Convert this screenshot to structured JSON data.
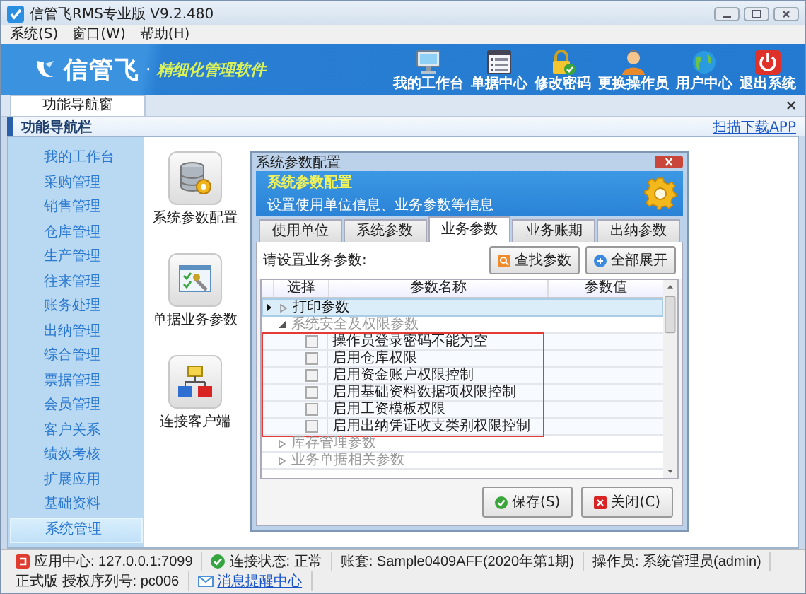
{
  "window": {
    "title": "信管飞RMS专业版 V9.2.480"
  },
  "menu": [
    {
      "label": "系统(S)"
    },
    {
      "label": "窗口(W)"
    },
    {
      "label": "帮助(H)"
    }
  ],
  "banner": {
    "logo": "信管飞",
    "separator": "·",
    "tagline": "精细化管理软件",
    "tools": [
      {
        "label": "我的工作台",
        "kind": "monitor"
      },
      {
        "label": "单据中心",
        "kind": "list"
      },
      {
        "label": "修改密码",
        "kind": "lock"
      },
      {
        "label": "更换操作员",
        "kind": "user"
      },
      {
        "label": "用户中心",
        "kind": "globe"
      },
      {
        "label": "退出系统",
        "kind": "power"
      }
    ]
  },
  "doc_tabs": [
    {
      "label": "功能导航窗",
      "selected": true
    }
  ],
  "nav": {
    "title": "功能导航栏",
    "link": "扫描下载APP",
    "items": [
      {
        "label": "我的工作台",
        "selected": false
      },
      {
        "label": "采购管理",
        "selected": false
      },
      {
        "label": "销售管理",
        "selected": false
      },
      {
        "label": "仓库管理",
        "selected": false
      },
      {
        "label": "生产管理",
        "selected": false
      },
      {
        "label": "往来管理",
        "selected": false
      },
      {
        "label": "账务处理",
        "selected": false
      },
      {
        "label": "出纳管理",
        "selected": false
      },
      {
        "label": "综合管理",
        "selected": false
      },
      {
        "label": "票据管理",
        "selected": false
      },
      {
        "label": "会员管理",
        "selected": false
      },
      {
        "label": "客户关系",
        "selected": false
      },
      {
        "label": "绩效考核",
        "selected": false
      },
      {
        "label": "扩展应用",
        "selected": false
      },
      {
        "label": "基础资料",
        "selected": false
      },
      {
        "label": "系统管理",
        "selected": true
      }
    ]
  },
  "shortcuts": [
    {
      "label": "系统参数配置",
      "kind": "database"
    },
    {
      "label": "单据业务参数",
      "kind": "form"
    },
    {
      "label": "连接客户端",
      "kind": "network"
    }
  ],
  "dialog": {
    "title": "系统参数配置",
    "header_title": "系统参数配置",
    "header_subtitle": "设置使用单位信息、业务参数等信息",
    "tabs": [
      {
        "label": "使用单位",
        "selected": false
      },
      {
        "label": "系统参数",
        "selected": false
      },
      {
        "label": "业务参数",
        "selected": true
      },
      {
        "label": "业务账期",
        "selected": false
      },
      {
        "label": "出纳参数",
        "selected": false
      }
    ],
    "prompt": "请设置业务参数:",
    "tools": [
      {
        "label": "查找参数",
        "kind": "search"
      },
      {
        "label": "全部展开",
        "kind": "expand"
      }
    ],
    "columns": [
      "选择",
      "参数名称",
      "参数值"
    ],
    "groups": [
      {
        "label": "打印参数",
        "expanded": false,
        "selected": true,
        "annotated": false
      },
      {
        "label": "系统安全及权限参数",
        "expanded": true,
        "selected": false,
        "annotated": true,
        "children": [
          {
            "label": "操作员登录密码不能为空",
            "checked": false
          },
          {
            "label": "启用仓库权限",
            "checked": false
          },
          {
            "label": "启用资金账户权限控制",
            "checked": false
          },
          {
            "label": "启用基础资料数据项权限控制",
            "checked": false
          },
          {
            "label": "启用工资模板权限",
            "checked": false
          },
          {
            "label": "启用出纳凭证收支类别权限控制",
            "checked": false
          }
        ]
      },
      {
        "label": "库存管理参数",
        "expanded": false,
        "selected": false,
        "annotated": false
      },
      {
        "label": "业务单据相关参数",
        "expanded": false,
        "selected": false,
        "annotated": false
      }
    ],
    "buttons": [
      {
        "label": "保存(S)",
        "kind": "save"
      },
      {
        "label": "关闭(C)",
        "kind": "close"
      }
    ]
  },
  "status_bar": [
    {
      "text": "应用中心: 127.0.0.1:7099",
      "kind": "app"
    },
    {
      "text": "连接状态: 正常",
      "kind": "ok"
    },
    {
      "text": "账套: Sample0409AFF(2020年第1期)",
      "kind": "plain"
    },
    {
      "text": "操作员: 系统管理员(admin)",
      "kind": "plain"
    },
    {
      "text": "正式版 授权序列号: pc006",
      "kind": "plain"
    },
    {
      "text": "消息提醒中心",
      "kind": "message"
    }
  ]
}
